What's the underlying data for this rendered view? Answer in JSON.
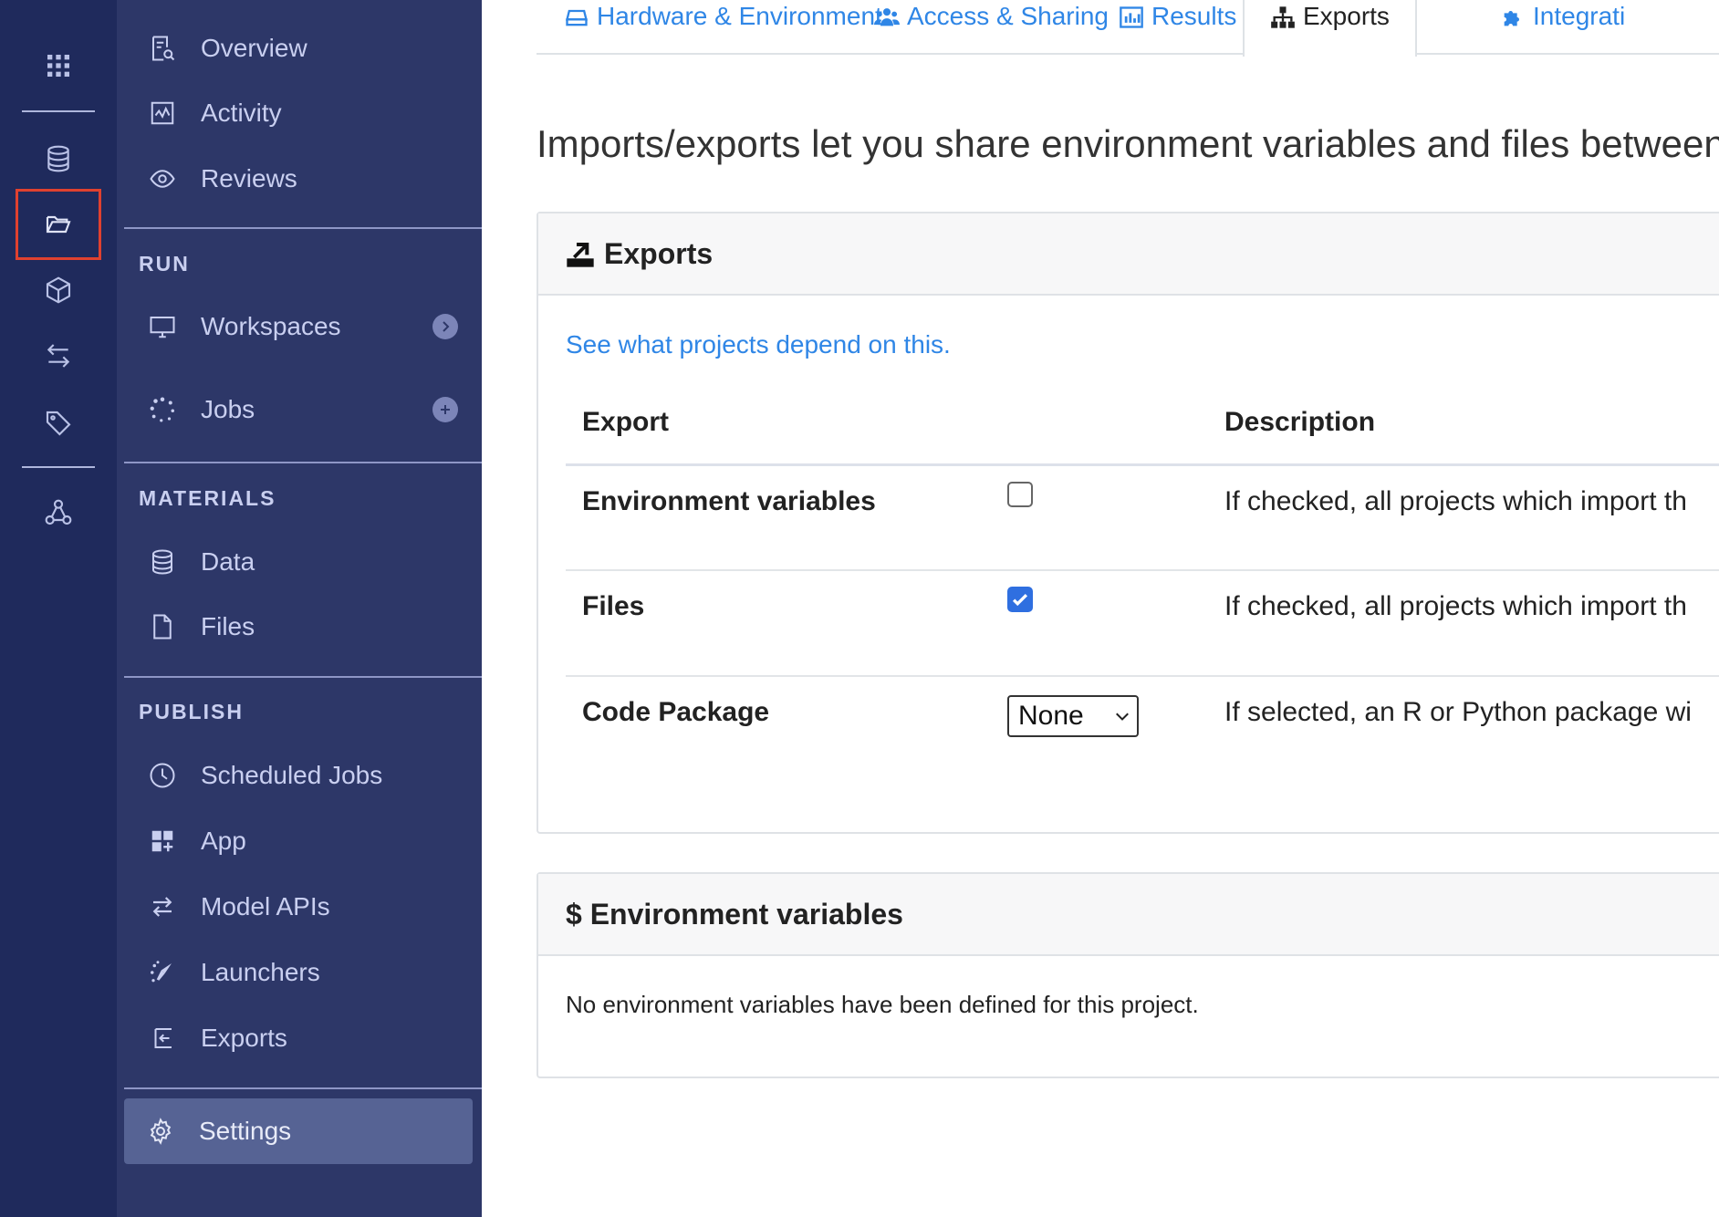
{
  "sidebar": {
    "top_items": [
      {
        "label": "Overview",
        "icon": "overview-icon"
      },
      {
        "label": "Activity",
        "icon": "activity-icon"
      },
      {
        "label": "Reviews",
        "icon": "eye-icon"
      }
    ],
    "sections": {
      "run": "RUN",
      "materials": "MATERIALS",
      "publish": "PUBLISH"
    },
    "run_items": [
      {
        "label": "Workspaces",
        "icon": "monitor-icon"
      },
      {
        "label": "Jobs",
        "icon": "jobs-icon"
      }
    ],
    "materials_items": [
      {
        "label": "Data",
        "icon": "database-icon"
      },
      {
        "label": "Files",
        "icon": "file-icon"
      }
    ],
    "publish_items": [
      {
        "label": "Scheduled Jobs",
        "icon": "clock-icon"
      },
      {
        "label": "App",
        "icon": "app-icon"
      },
      {
        "label": "Model APIs",
        "icon": "swap-icon"
      },
      {
        "label": "Launchers",
        "icon": "launcher-icon"
      },
      {
        "label": "Exports",
        "icon": "export-icon"
      }
    ],
    "settings_label": "Settings"
  },
  "tabs": [
    {
      "label": "Hardware & Environment",
      "icon": "hardware-icon"
    },
    {
      "label": "Access & Sharing",
      "icon": "users-icon"
    },
    {
      "label": "Results",
      "icon": "results-icon"
    },
    {
      "label": "Exports",
      "icon": "sitemap-icon",
      "active": true
    },
    {
      "label": "Integrati",
      "icon": "puzzle-icon"
    }
  ],
  "intro_text": "Imports/exports let you share environment variables and files between p",
  "exports_card": {
    "title": "Exports",
    "link": "See what projects depend on this.",
    "columns": {
      "export": "Export",
      "description": "Description"
    },
    "rows": [
      {
        "name": "Environment variables",
        "control": "checkbox",
        "checked": false,
        "description": "If checked, all projects which import th"
      },
      {
        "name": "Files",
        "control": "checkbox",
        "checked": true,
        "description": "If checked, all projects which import th"
      },
      {
        "name": "Code Package",
        "control": "select",
        "selected": "None",
        "description": "If selected, an R or Python package wi"
      }
    ]
  },
  "env_card": {
    "title": "$ Environment variables",
    "empty_text": "No environment variables have been defined for this project."
  },
  "colors": {
    "rail_bg": "#1f2a5c",
    "sidebar_bg": "#2d3768",
    "active_bg": "#566394",
    "link": "#2f86e6",
    "highlight_border": "#e0412f",
    "checkbox_on": "#2f6fe0"
  }
}
